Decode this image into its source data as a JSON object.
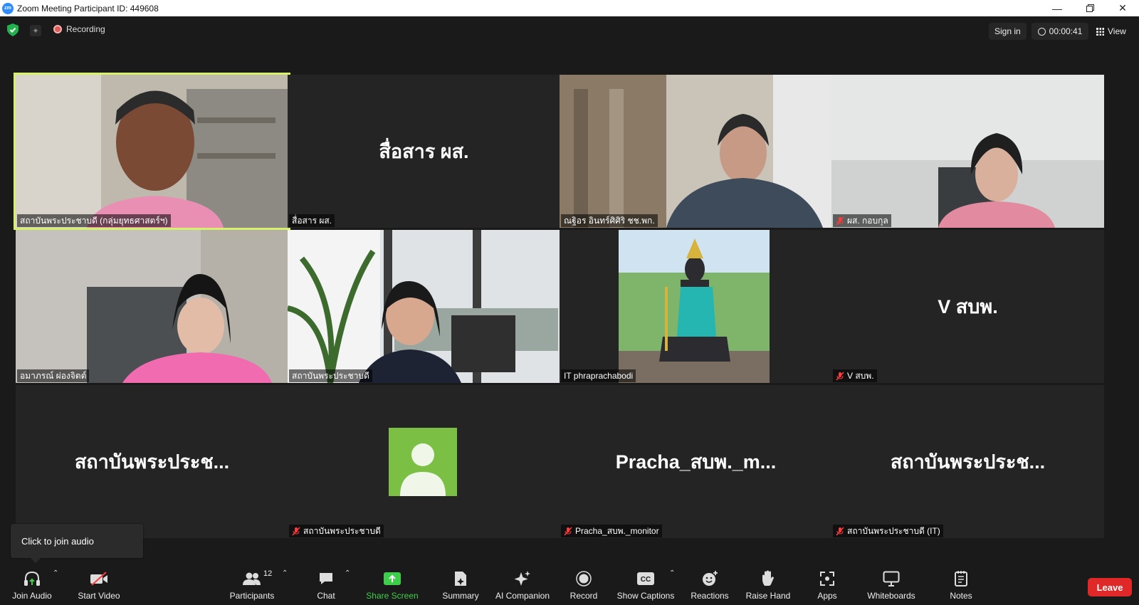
{
  "window": {
    "title": "Zoom Meeting Participant ID: 449608"
  },
  "topbar": {
    "recording_label": "Recording",
    "signin_label": "Sign in",
    "timer": "00:00:41",
    "view_label": "View"
  },
  "tiles": [
    {
      "name": "สถาบันพระประชาบดี (กลุ่มยุทธศาสตร์ฯ)",
      "big": "",
      "muted": false,
      "active": true
    },
    {
      "name": "สื่อสาร ผส.",
      "big": "สื่อสาร ผส.",
      "muted": false,
      "active": false
    },
    {
      "name": "ณฐิอร อินทร์ศิศิริ ชช.พก.",
      "big": "",
      "muted": false,
      "active": false
    },
    {
      "name": "ผส. กอบกุล",
      "big": "",
      "muted": true,
      "active": false
    },
    {
      "name": "อมาภรณ์ ผ่องจิตต์",
      "big": "",
      "muted": false,
      "active": false
    },
    {
      "name": "สถาบันพระประชาบดี",
      "big": "",
      "muted": false,
      "active": false
    },
    {
      "name": "IT phraprachabodi",
      "big": "",
      "muted": false,
      "active": false
    },
    {
      "name": "V สบพ.",
      "big": "V สบพ.",
      "muted": true,
      "active": false
    },
    {
      "name": "",
      "big": "สถาบันพระประช...",
      "muted": false,
      "active": false
    },
    {
      "name": "สถาบันพระประชาบดี",
      "big": "",
      "muted": true,
      "active": false
    },
    {
      "name": "Pracha_สบพ._monitor",
      "big": "Pracha_สบพ._m...",
      "muted": true,
      "active": false
    },
    {
      "name": "สถาบันพระประชาบดี (IT)",
      "big": "สถาบันพระประช...",
      "muted": true,
      "active": false
    }
  ],
  "tooltip": {
    "text": "Click to join audio"
  },
  "toolbar": {
    "join_audio": "Join Audio",
    "start_video": "Start Video",
    "participants": "Participants",
    "participants_count": "12",
    "chat": "Chat",
    "share_screen": "Share Screen",
    "summary": "Summary",
    "ai_companion": "AI Companion",
    "record": "Record",
    "show_captions": "Show Captions",
    "reactions": "Reactions",
    "raise_hand": "Raise Hand",
    "apps": "Apps",
    "whiteboards": "Whiteboards",
    "notes": "Notes",
    "leave": "Leave"
  },
  "colors": {
    "active_speaker_border": "#d5f06a",
    "share_green": "#3ecf4a",
    "leave_red": "#e02828",
    "avatar_green": "#7bbf45"
  }
}
